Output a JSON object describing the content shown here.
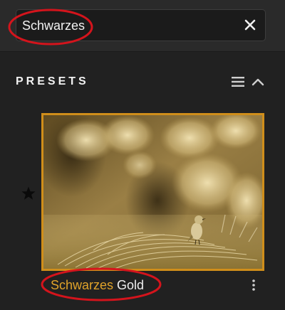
{
  "search": {
    "value": "Schwarzes",
    "clear_icon": "close-icon"
  },
  "presets_panel": {
    "title": "PRESETS",
    "menu_icon": "hamburger-menu-icon",
    "collapse_icon": "chevron-up-icon",
    "items": [
      {
        "name_highlight": "Schwarzes",
        "name_rest": " Gold",
        "favorite": true,
        "more_icon": "vertical-ellipsis-icon"
      }
    ]
  },
  "colors": {
    "background": "#212121",
    "search_bar": "#2a2a2a",
    "accent_gold": "#e0a32a",
    "thumbnail_border": "#d08e1a",
    "annotation_red": "#d4141c"
  }
}
